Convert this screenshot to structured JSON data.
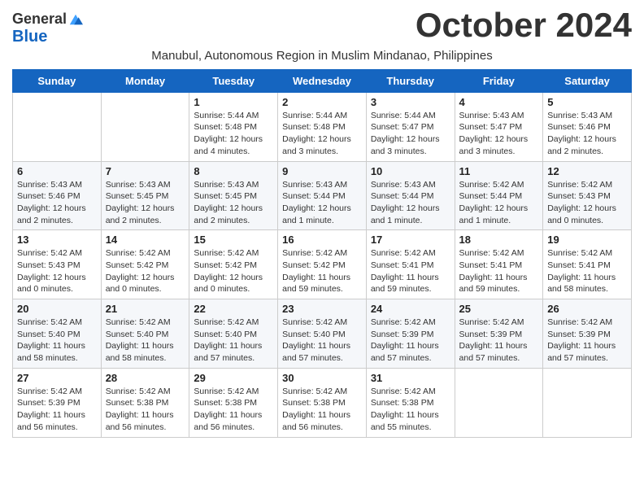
{
  "logo": {
    "line1": "General",
    "line2": "Blue"
  },
  "title": "October 2024",
  "subtitle": "Manubul, Autonomous Region in Muslim Mindanao, Philippines",
  "days_of_week": [
    "Sunday",
    "Monday",
    "Tuesday",
    "Wednesday",
    "Thursday",
    "Friday",
    "Saturday"
  ],
  "weeks": [
    [
      {
        "day": "",
        "info": ""
      },
      {
        "day": "",
        "info": ""
      },
      {
        "day": "1",
        "info": "Sunrise: 5:44 AM\nSunset: 5:48 PM\nDaylight: 12 hours\nand 4 minutes."
      },
      {
        "day": "2",
        "info": "Sunrise: 5:44 AM\nSunset: 5:48 PM\nDaylight: 12 hours\nand 3 minutes."
      },
      {
        "day": "3",
        "info": "Sunrise: 5:44 AM\nSunset: 5:47 PM\nDaylight: 12 hours\nand 3 minutes."
      },
      {
        "day": "4",
        "info": "Sunrise: 5:43 AM\nSunset: 5:47 PM\nDaylight: 12 hours\nand 3 minutes."
      },
      {
        "day": "5",
        "info": "Sunrise: 5:43 AM\nSunset: 5:46 PM\nDaylight: 12 hours\nand 2 minutes."
      }
    ],
    [
      {
        "day": "6",
        "info": "Sunrise: 5:43 AM\nSunset: 5:46 PM\nDaylight: 12 hours\nand 2 minutes."
      },
      {
        "day": "7",
        "info": "Sunrise: 5:43 AM\nSunset: 5:45 PM\nDaylight: 12 hours\nand 2 minutes."
      },
      {
        "day": "8",
        "info": "Sunrise: 5:43 AM\nSunset: 5:45 PM\nDaylight: 12 hours\nand 2 minutes."
      },
      {
        "day": "9",
        "info": "Sunrise: 5:43 AM\nSunset: 5:44 PM\nDaylight: 12 hours\nand 1 minute."
      },
      {
        "day": "10",
        "info": "Sunrise: 5:43 AM\nSunset: 5:44 PM\nDaylight: 12 hours\nand 1 minute."
      },
      {
        "day": "11",
        "info": "Sunrise: 5:42 AM\nSunset: 5:44 PM\nDaylight: 12 hours\nand 1 minute."
      },
      {
        "day": "12",
        "info": "Sunrise: 5:42 AM\nSunset: 5:43 PM\nDaylight: 12 hours\nand 0 minutes."
      }
    ],
    [
      {
        "day": "13",
        "info": "Sunrise: 5:42 AM\nSunset: 5:43 PM\nDaylight: 12 hours\nand 0 minutes."
      },
      {
        "day": "14",
        "info": "Sunrise: 5:42 AM\nSunset: 5:42 PM\nDaylight: 12 hours\nand 0 minutes."
      },
      {
        "day": "15",
        "info": "Sunrise: 5:42 AM\nSunset: 5:42 PM\nDaylight: 12 hours\nand 0 minutes."
      },
      {
        "day": "16",
        "info": "Sunrise: 5:42 AM\nSunset: 5:42 PM\nDaylight: 11 hours\nand 59 minutes."
      },
      {
        "day": "17",
        "info": "Sunrise: 5:42 AM\nSunset: 5:41 PM\nDaylight: 11 hours\nand 59 minutes."
      },
      {
        "day": "18",
        "info": "Sunrise: 5:42 AM\nSunset: 5:41 PM\nDaylight: 11 hours\nand 59 minutes."
      },
      {
        "day": "19",
        "info": "Sunrise: 5:42 AM\nSunset: 5:41 PM\nDaylight: 11 hours\nand 58 minutes."
      }
    ],
    [
      {
        "day": "20",
        "info": "Sunrise: 5:42 AM\nSunset: 5:40 PM\nDaylight: 11 hours\nand 58 minutes."
      },
      {
        "day": "21",
        "info": "Sunrise: 5:42 AM\nSunset: 5:40 PM\nDaylight: 11 hours\nand 58 minutes."
      },
      {
        "day": "22",
        "info": "Sunrise: 5:42 AM\nSunset: 5:40 PM\nDaylight: 11 hours\nand 57 minutes."
      },
      {
        "day": "23",
        "info": "Sunrise: 5:42 AM\nSunset: 5:40 PM\nDaylight: 11 hours\nand 57 minutes."
      },
      {
        "day": "24",
        "info": "Sunrise: 5:42 AM\nSunset: 5:39 PM\nDaylight: 11 hours\nand 57 minutes."
      },
      {
        "day": "25",
        "info": "Sunrise: 5:42 AM\nSunset: 5:39 PM\nDaylight: 11 hours\nand 57 minutes."
      },
      {
        "day": "26",
        "info": "Sunrise: 5:42 AM\nSunset: 5:39 PM\nDaylight: 11 hours\nand 57 minutes."
      }
    ],
    [
      {
        "day": "27",
        "info": "Sunrise: 5:42 AM\nSunset: 5:39 PM\nDaylight: 11 hours\nand 56 minutes."
      },
      {
        "day": "28",
        "info": "Sunrise: 5:42 AM\nSunset: 5:38 PM\nDaylight: 11 hours\nand 56 minutes."
      },
      {
        "day": "29",
        "info": "Sunrise: 5:42 AM\nSunset: 5:38 PM\nDaylight: 11 hours\nand 56 minutes."
      },
      {
        "day": "30",
        "info": "Sunrise: 5:42 AM\nSunset: 5:38 PM\nDaylight: 11 hours\nand 56 minutes."
      },
      {
        "day": "31",
        "info": "Sunrise: 5:42 AM\nSunset: 5:38 PM\nDaylight: 11 hours\nand 55 minutes."
      },
      {
        "day": "",
        "info": ""
      },
      {
        "day": "",
        "info": ""
      }
    ]
  ]
}
